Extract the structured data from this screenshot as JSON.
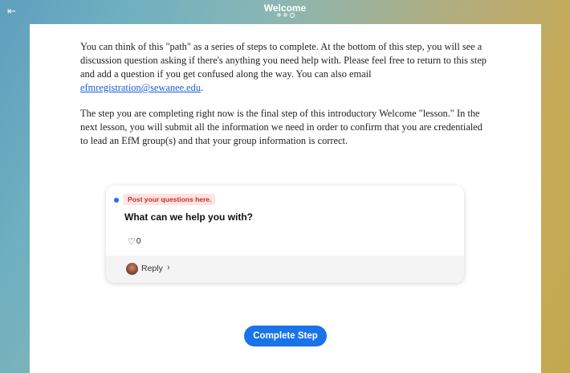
{
  "header": {
    "title": "Welcome",
    "exit_icon": "exit-icon",
    "progress_dots": 3,
    "current_step": 3
  },
  "content": {
    "p1_before_link": "You can think of this \"path\" as a series of steps to complete. At the bottom of this step, you will see a discussion question asking if there's anything you need help with. Please feel free to return to this step and add a question if you get confused along the way. You can also email ",
    "email_link": "efmregistration@sewanee.edu",
    "p1_after_link": ".",
    "p2": "The step you are completing right now is the final step of this introductory Welcome \"lesson.\" In the next lesson, you will submit all the information we need in order to confirm that you are credentialed to lead an EfM group(s) and that your group information is correct."
  },
  "post": {
    "badge": "Post your questions here.",
    "title": "What can we help you with?",
    "like_count": "0",
    "reply_label": "Reply"
  },
  "footer": {
    "complete_label": "Complete Step"
  },
  "colors": {
    "accent": "#1a73e8",
    "badge_bg": "#fde3e1",
    "badge_text": "#c8302a"
  }
}
